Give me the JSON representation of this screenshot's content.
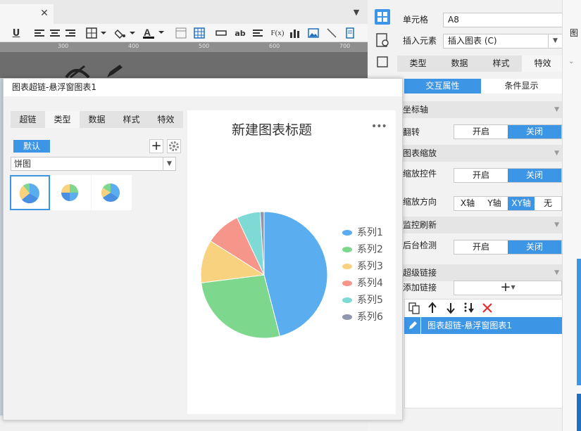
{
  "editor": {
    "ruler_ticks": [
      "300",
      "400",
      "500",
      "600",
      "700"
    ]
  },
  "properties": {
    "cell_label": "单元格",
    "cell_value": "A8",
    "insert_label": "插入元素",
    "insert_value": "插入图表 (C)",
    "tabs": [
      {
        "label": "类型"
      },
      {
        "label": "数据"
      },
      {
        "label": "样式"
      },
      {
        "label": "特效"
      }
    ],
    "subtabs": {
      "interactive": "交互属性",
      "conditional": "条件显示"
    },
    "axis_section": "坐标轴",
    "flip_label": "翻转",
    "flip_options": {
      "on": "开启",
      "off": "关闭"
    },
    "zoom_section": "图表缩放",
    "zoom_control_label": "缩放控件",
    "zoom_control_options": {
      "on": "开启",
      "off": "关闭"
    },
    "zoom_dir_label": "缩放方向",
    "zoom_dir_options": [
      "X轴",
      "Y轴",
      "XY轴",
      "无"
    ],
    "monitor_section": "监控刷新",
    "bg_check_label": "后台检测",
    "bg_check_options": {
      "on": "开启",
      "off": "关闭"
    },
    "hyperlink_section": "超级链接",
    "add_link_label": "添加链接",
    "link_items": [
      "图表超链-悬浮窗图表1"
    ],
    "right_edge_text": "图"
  },
  "dialog": {
    "title": "图表超链-悬浮窗图表1",
    "tabs": [
      {
        "label": "超链"
      },
      {
        "label": "类型"
      },
      {
        "label": "数据"
      },
      {
        "label": "样式"
      },
      {
        "label": "特效"
      }
    ],
    "default_label": "默认",
    "chart_type": "饼图"
  },
  "chart_data": {
    "type": "pie",
    "title": "新建图表标题",
    "legend_position": "right",
    "series": [
      {
        "name": "系列1",
        "value": 46,
        "color": "#5AAEF0"
      },
      {
        "name": "系列2",
        "value": 27,
        "color": "#7DD88E"
      },
      {
        "name": "系列3",
        "value": 11,
        "color": "#F8D27E"
      },
      {
        "name": "系列4",
        "value": 9,
        "color": "#F6958A"
      },
      {
        "name": "系列5",
        "value": 6,
        "color": "#7FD9D4"
      },
      {
        "name": "系列6",
        "value": 1,
        "color": "#8E97AD"
      }
    ]
  },
  "colors": {
    "accent": "#3d95e6",
    "delete": "#e03030"
  }
}
